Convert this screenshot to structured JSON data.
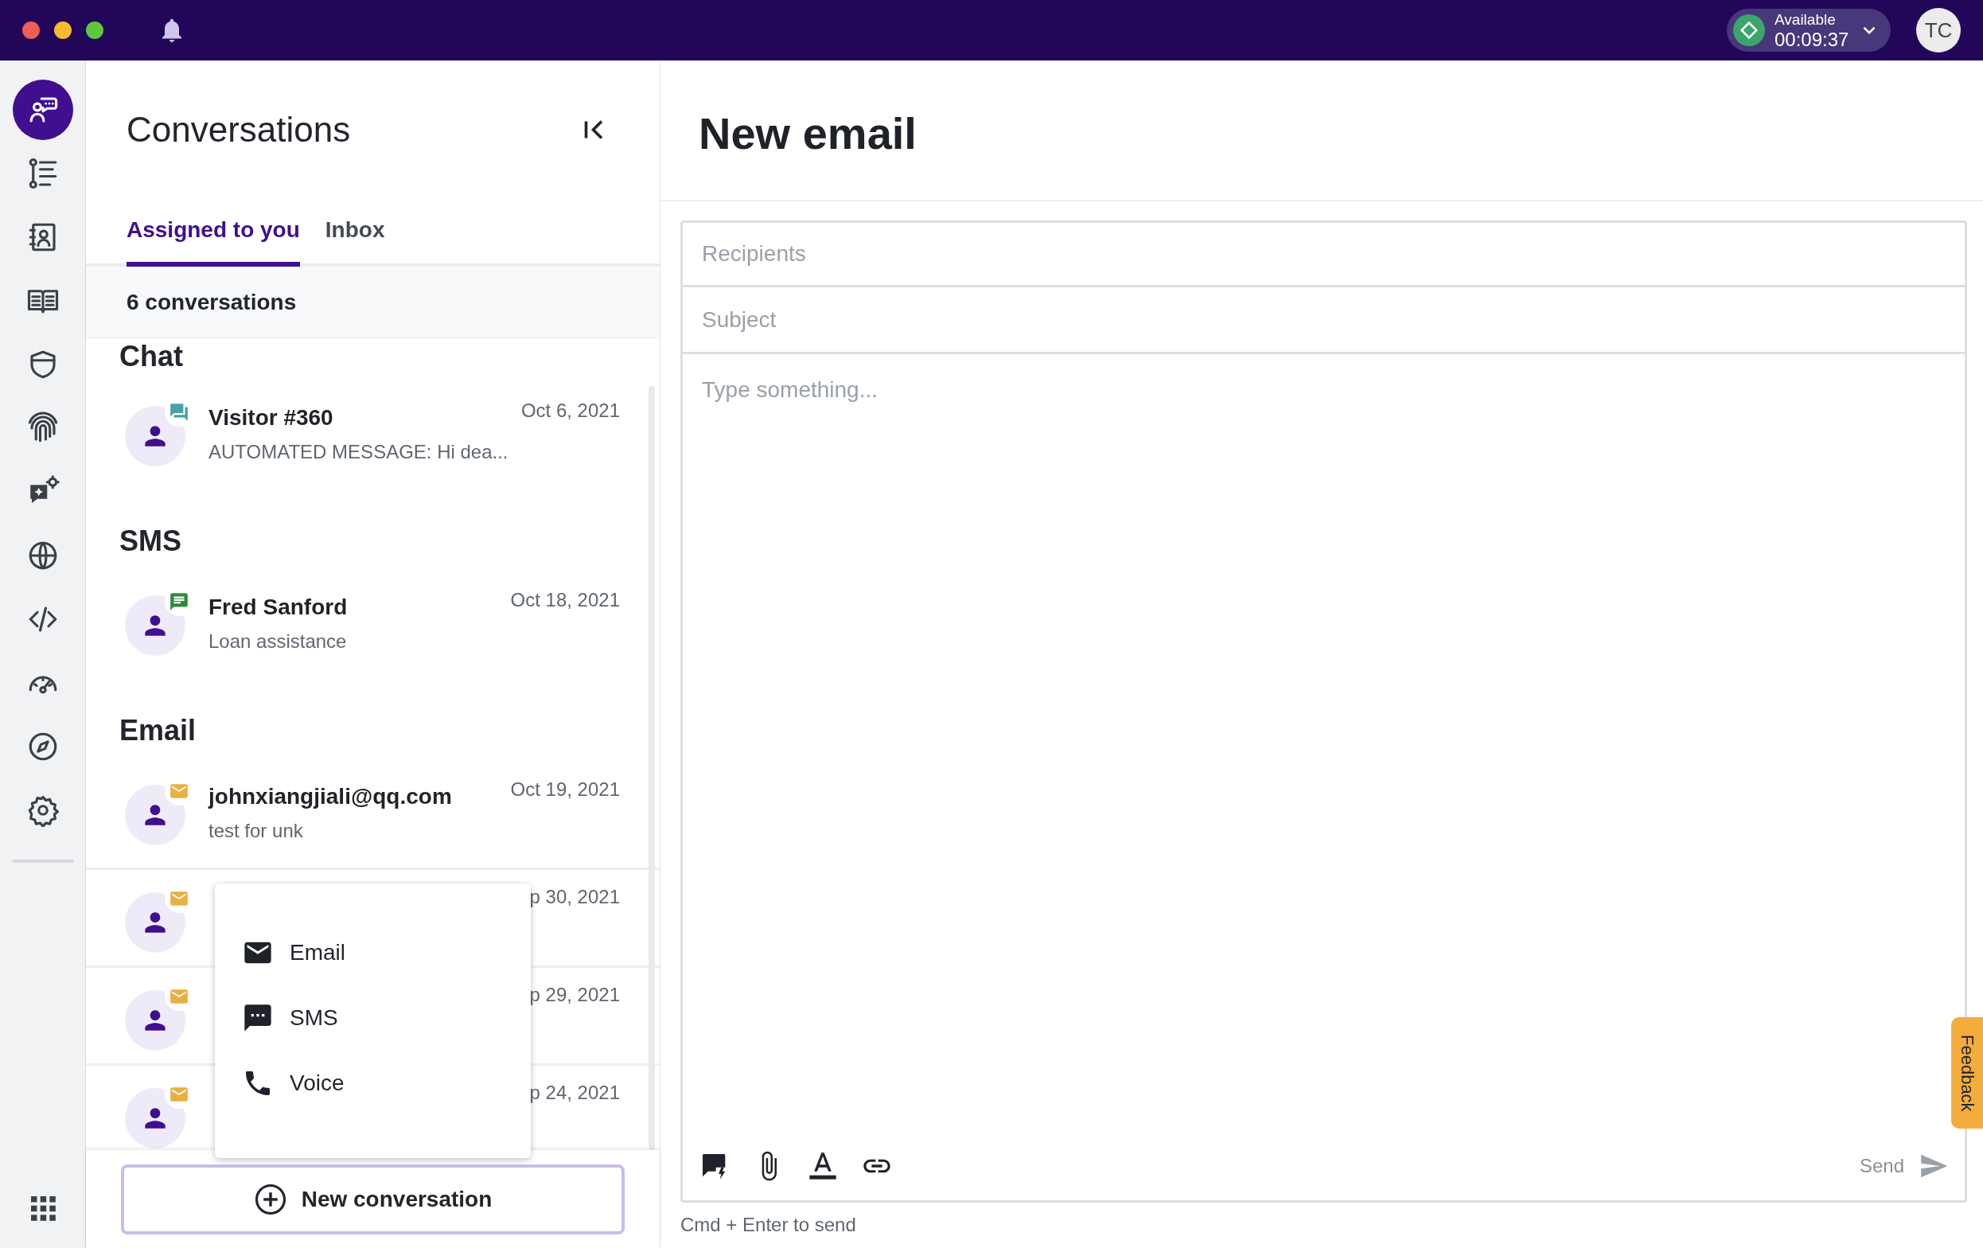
{
  "top_bar": {
    "status": {
      "label": "Available",
      "timer": "00:09:37"
    },
    "avatar": "TC"
  },
  "nav_rail": [
    {
      "selected": true
    },
    {
      "selected": false
    },
    {
      "selected": false
    },
    {
      "selected": false
    },
    {
      "selected": false
    },
    {
      "selected": false
    },
    {
      "selected": false
    },
    {
      "selected": false
    },
    {
      "selected": false
    },
    {
      "selected": false
    },
    {
      "selected": false
    },
    {
      "selected": false
    }
  ],
  "conversations": {
    "title": "Conversations",
    "tabs": [
      {
        "label": "Assigned to you",
        "selected": true
      },
      {
        "label": "Inbox",
        "selected": false
      }
    ],
    "count": "6 conversations",
    "groups": [
      {
        "heading": "Chat",
        "kind": "chat",
        "items": [
          {
            "name": "Visitor #360",
            "preview": "AUTOMATED MESSAGE: Hi dea...",
            "date": "Oct 6, 2021"
          }
        ]
      },
      {
        "heading": "SMS",
        "kind": "sms",
        "items": [
          {
            "name": "Fred Sanford",
            "preview": "Loan assistance",
            "date": "Oct 18, 2021"
          }
        ]
      },
      {
        "heading": "Email",
        "kind": "email",
        "items": [
          {
            "name": "johnxiangjiali@qq.com",
            "preview": "test for unk",
            "date": "Oct 19, 2021"
          },
          {
            "date": "p 30, 2021"
          },
          {
            "date": "p 29, 2021"
          },
          {
            "date": "p 24, 2021"
          }
        ]
      }
    ],
    "new_button": "New conversation"
  },
  "new_menu": [
    {
      "label": "Email"
    },
    {
      "label": "SMS"
    },
    {
      "label": "Voice"
    }
  ],
  "composer": {
    "title": "New email",
    "recipients": {
      "placeholder": "Recipients"
    },
    "subject": {
      "placeholder": "Subject"
    },
    "body": {
      "placeholder": "Type something..."
    },
    "send": "Send",
    "hint": "Cmd + Enter to send"
  },
  "feedback": "Feedback"
}
